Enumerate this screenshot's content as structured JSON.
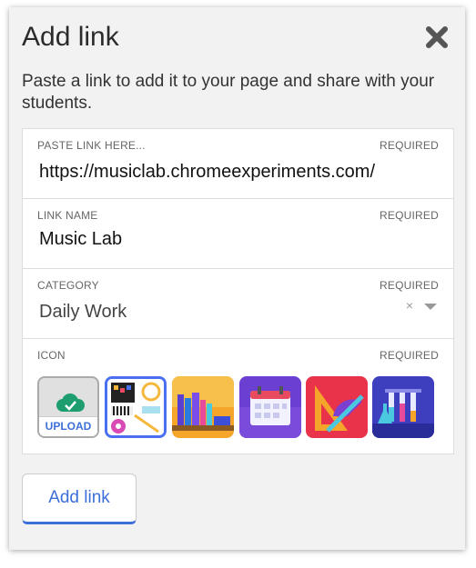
{
  "dialog": {
    "title": "Add link",
    "close_icon": "close-icon",
    "description": "Paste a link to add it to your page and share with your students."
  },
  "fields": {
    "link": {
      "label": "PASTE LINK HERE...",
      "required": "REQUIRED",
      "value": "https://musiclab.chromeexperiments.com/"
    },
    "name": {
      "label": "LINK NAME",
      "required": "REQUIRED",
      "value": "Music Lab"
    },
    "category": {
      "label": "CATEGORY",
      "required": "REQUIRED",
      "value": "Daily Work",
      "clear_glyph": "×"
    },
    "icon": {
      "label": "ICON",
      "required": "REQUIRED",
      "upload_label": "UPLOAD",
      "options": [
        "upload-icon",
        "music-lab-icon",
        "books-icon",
        "calendar-icon",
        "geometry-tools-icon",
        "science-flasks-icon"
      ],
      "selected": "music-lab-icon"
    }
  },
  "actions": {
    "add_link_label": "Add link"
  },
  "colors": {
    "accent": "#3d6fd9",
    "selected_border": "#4a6ff0",
    "upload_cloud": "#1e9e6f"
  }
}
